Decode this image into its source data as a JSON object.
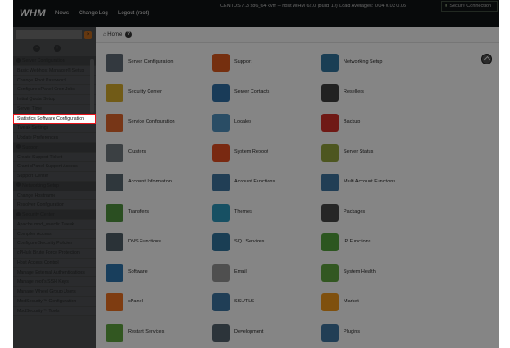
{
  "topbar": {
    "logo": "WHM",
    "nav": {
      "news": "News",
      "changelog": "Change Log",
      "logout": "Logout (root)"
    },
    "system_info": "CENTOS 7.3 x86_64 kvm – host    WHM 62.0 (build 17)    Load Averages: 0.04 0.03 0.05",
    "secure_label": "Secure Connection"
  },
  "breadcrumb": {
    "home": "Home",
    "help_icon": "?"
  },
  "sidebar": {
    "search_placeholder": "",
    "items": [
      {
        "label": "Server Configuration",
        "type": "section"
      },
      {
        "label": "Basic Webhost Manager® Setup",
        "type": "item"
      },
      {
        "label": "Change Root Password",
        "type": "item"
      },
      {
        "label": "Configure cPanel Cron Jobs",
        "type": "item"
      },
      {
        "label": "Initial Quota Setup",
        "type": "item"
      },
      {
        "label": "Server Time",
        "type": "item"
      },
      {
        "label": "Statistics Software Configuration",
        "type": "highlight"
      },
      {
        "label": "Tweak Settings",
        "type": "item"
      },
      {
        "label": "Update Preferences",
        "type": "item"
      },
      {
        "label": "Support",
        "type": "section"
      },
      {
        "label": "Create Support Ticket",
        "type": "item"
      },
      {
        "label": "Grant cPanel Support Access",
        "type": "item"
      },
      {
        "label": "Support Center",
        "type": "item"
      },
      {
        "label": "Networking Setup",
        "type": "section"
      },
      {
        "label": "Change Hostname",
        "type": "item"
      },
      {
        "label": "Resolver Configuration",
        "type": "item"
      },
      {
        "label": "Security Center",
        "type": "section"
      },
      {
        "label": "Apache mod_userdir Tweak",
        "type": "item"
      },
      {
        "label": "Compiler Access",
        "type": "item"
      },
      {
        "label": "Configure Security Policies",
        "type": "item"
      },
      {
        "label": "cPHulk Brute Force Protection",
        "type": "item"
      },
      {
        "label": "Host Access Control",
        "type": "item"
      },
      {
        "label": "Manage External Authentications",
        "type": "item"
      },
      {
        "label": "Manage root's SSH Keys",
        "type": "item"
      },
      {
        "label": "Manage Wheel Group Users",
        "type": "item"
      },
      {
        "label": "ModSecurity™ Configuration",
        "type": "item"
      },
      {
        "label": "ModSecurity™ Tools",
        "type": "item"
      }
    ]
  },
  "grid": [
    [
      {
        "label": "Server Configuration",
        "icon": "server-configuration-icon",
        "color": "#5b6770"
      },
      {
        "label": "Support",
        "icon": "support-icon",
        "color": "#d0541c"
      },
      {
        "label": "Networking Setup",
        "icon": "networking-setup-icon",
        "color": "#2f6f97"
      }
    ],
    [
      {
        "label": "Security Center",
        "icon": "security-center-icon",
        "color": "#c9a22a"
      },
      {
        "label": "Server Contacts",
        "icon": "server-contacts-icon",
        "color": "#2e6a9e"
      },
      {
        "label": "Resellers",
        "icon": "resellers-icon",
        "color": "#3c3c3c"
      }
    ],
    [
      {
        "label": "Service Configuration",
        "icon": "service-configuration-icon",
        "color": "#d5612a"
      },
      {
        "label": "Locales",
        "icon": "locales-icon",
        "color": "#4b89b5"
      },
      {
        "label": "Backup",
        "icon": "backup-icon",
        "color": "#c62d27"
      }
    ],
    [
      {
        "label": "Clusters",
        "icon": "clusters-icon",
        "color": "#6a7278"
      },
      {
        "label": "System Reboot",
        "icon": "system-reboot-icon",
        "color": "#d84a1f"
      },
      {
        "label": "Server Status",
        "icon": "server-status-icon",
        "color": "#8a9a3a"
      }
    ],
    [
      {
        "label": "Account Information",
        "icon": "account-information-icon",
        "color": "#55626b"
      },
      {
        "label": "Account Functions",
        "icon": "account-functions-icon",
        "color": "#3b6f98"
      },
      {
        "label": "Multi Account Functions",
        "icon": "multi-account-functions-icon",
        "color": "#3b6f98"
      }
    ],
    [
      {
        "label": "Transfers",
        "icon": "transfers-icon",
        "color": "#4c8c3c"
      },
      {
        "label": "Themes",
        "icon": "themes-icon",
        "color": "#2a8fb0"
      },
      {
        "label": "Packages",
        "icon": "packages-icon",
        "color": "#454545"
      }
    ],
    [
      {
        "label": "DNS Functions",
        "icon": "dns-functions-icon",
        "color": "#4b5a63"
      },
      {
        "label": "SQL Services",
        "icon": "sql-services-icon",
        "color": "#2f6f97"
      },
      {
        "label": "IP Functions",
        "icon": "ip-functions-icon",
        "color": "#4f9a3a"
      }
    ],
    [
      {
        "label": "Software",
        "icon": "software-icon",
        "color": "#2c6fa5"
      },
      {
        "label": "Email",
        "icon": "email-icon",
        "color": "#8e8e8e"
      },
      {
        "label": "System Health",
        "icon": "system-health-icon",
        "color": "#5a9b3c"
      }
    ],
    [
      {
        "label": "cPanel",
        "icon": "cpanel-icon",
        "color": "#e06b1f"
      },
      {
        "label": "SSL/TLS",
        "icon": "ssl-tls-icon",
        "color": "#3a6f9a"
      },
      {
        "label": "Market",
        "icon": "market-icon",
        "color": "#e38f1a"
      }
    ],
    [
      {
        "label": "Restart Services",
        "icon": "restart-services-icon",
        "color": "#5a9b3c"
      },
      {
        "label": "Development",
        "icon": "development-icon",
        "color": "#4f5e68"
      },
      {
        "label": "Plugins",
        "icon": "plugins-icon",
        "color": "#3b6f98"
      }
    ]
  ],
  "colors": {
    "accent_highlight": "#e8141b",
    "topbar_bg": "#0f1214",
    "search_button": "#b5641e"
  }
}
